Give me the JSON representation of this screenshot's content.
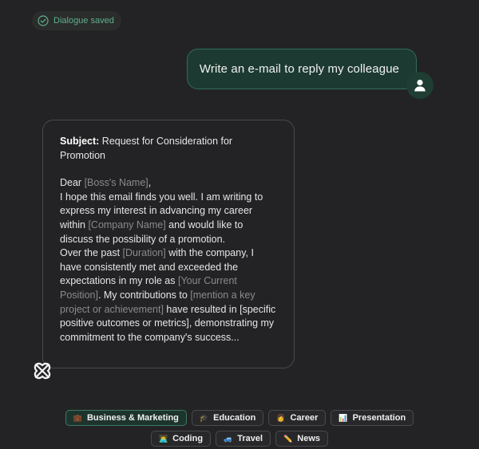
{
  "status": {
    "saved_text": "Dialogue saved",
    "icon": "check-circle-icon"
  },
  "user_message": {
    "text": "Write an e-mail to reply my colleague",
    "avatar_icon": "user-icon"
  },
  "ai_response": {
    "subject_label": "Subject:",
    "subject_text": "Request for Consideration for Promotion",
    "greeting_prefix": "Dear ",
    "boss_name": "[Boss's Name]",
    "greeting_suffix": ",",
    "p1": "I hope this email finds you well. I am writing to express my interest in advancing my career within ",
    "company_name": "[Company Name]",
    "p1b": " and would like to discuss the possibility of a promotion.",
    "p2a": "Over the past ",
    "duration": "[Duration]",
    "p2b": " with the company, I have consistently met and exceeded the expectations in my role as ",
    "position": "[Your Current Position]",
    "p2c": ". My contributions to ",
    "key_project": "[mention a key project or achievement]",
    "p2d": " have resulted in [specific positive outcomes or metrics], demonstrating my commitment to the company's success...",
    "logo_icon": "ai-knot-logo-icon"
  },
  "categories": {
    "row1": [
      {
        "label": "Business & Marketing",
        "icon": "💼",
        "active": true
      },
      {
        "label": "Education",
        "icon": "🎓",
        "active": false
      },
      {
        "label": "Career",
        "icon": "👩",
        "active": false
      },
      {
        "label": "Presentation",
        "icon": "📊",
        "active": false
      }
    ],
    "row2": [
      {
        "label": "Coding",
        "icon": "👨‍💻",
        "active": false
      },
      {
        "label": "Travel",
        "icon": "🚙",
        "active": false
      },
      {
        "label": "News",
        "icon": "✏️",
        "active": false
      }
    ]
  },
  "colors": {
    "background": "#232325",
    "accent_green": "#5fae8d",
    "user_bubble_bg": "#1c3a31",
    "user_bubble_border": "#2f6d59",
    "placeholder_text": "#8a8a8e"
  }
}
